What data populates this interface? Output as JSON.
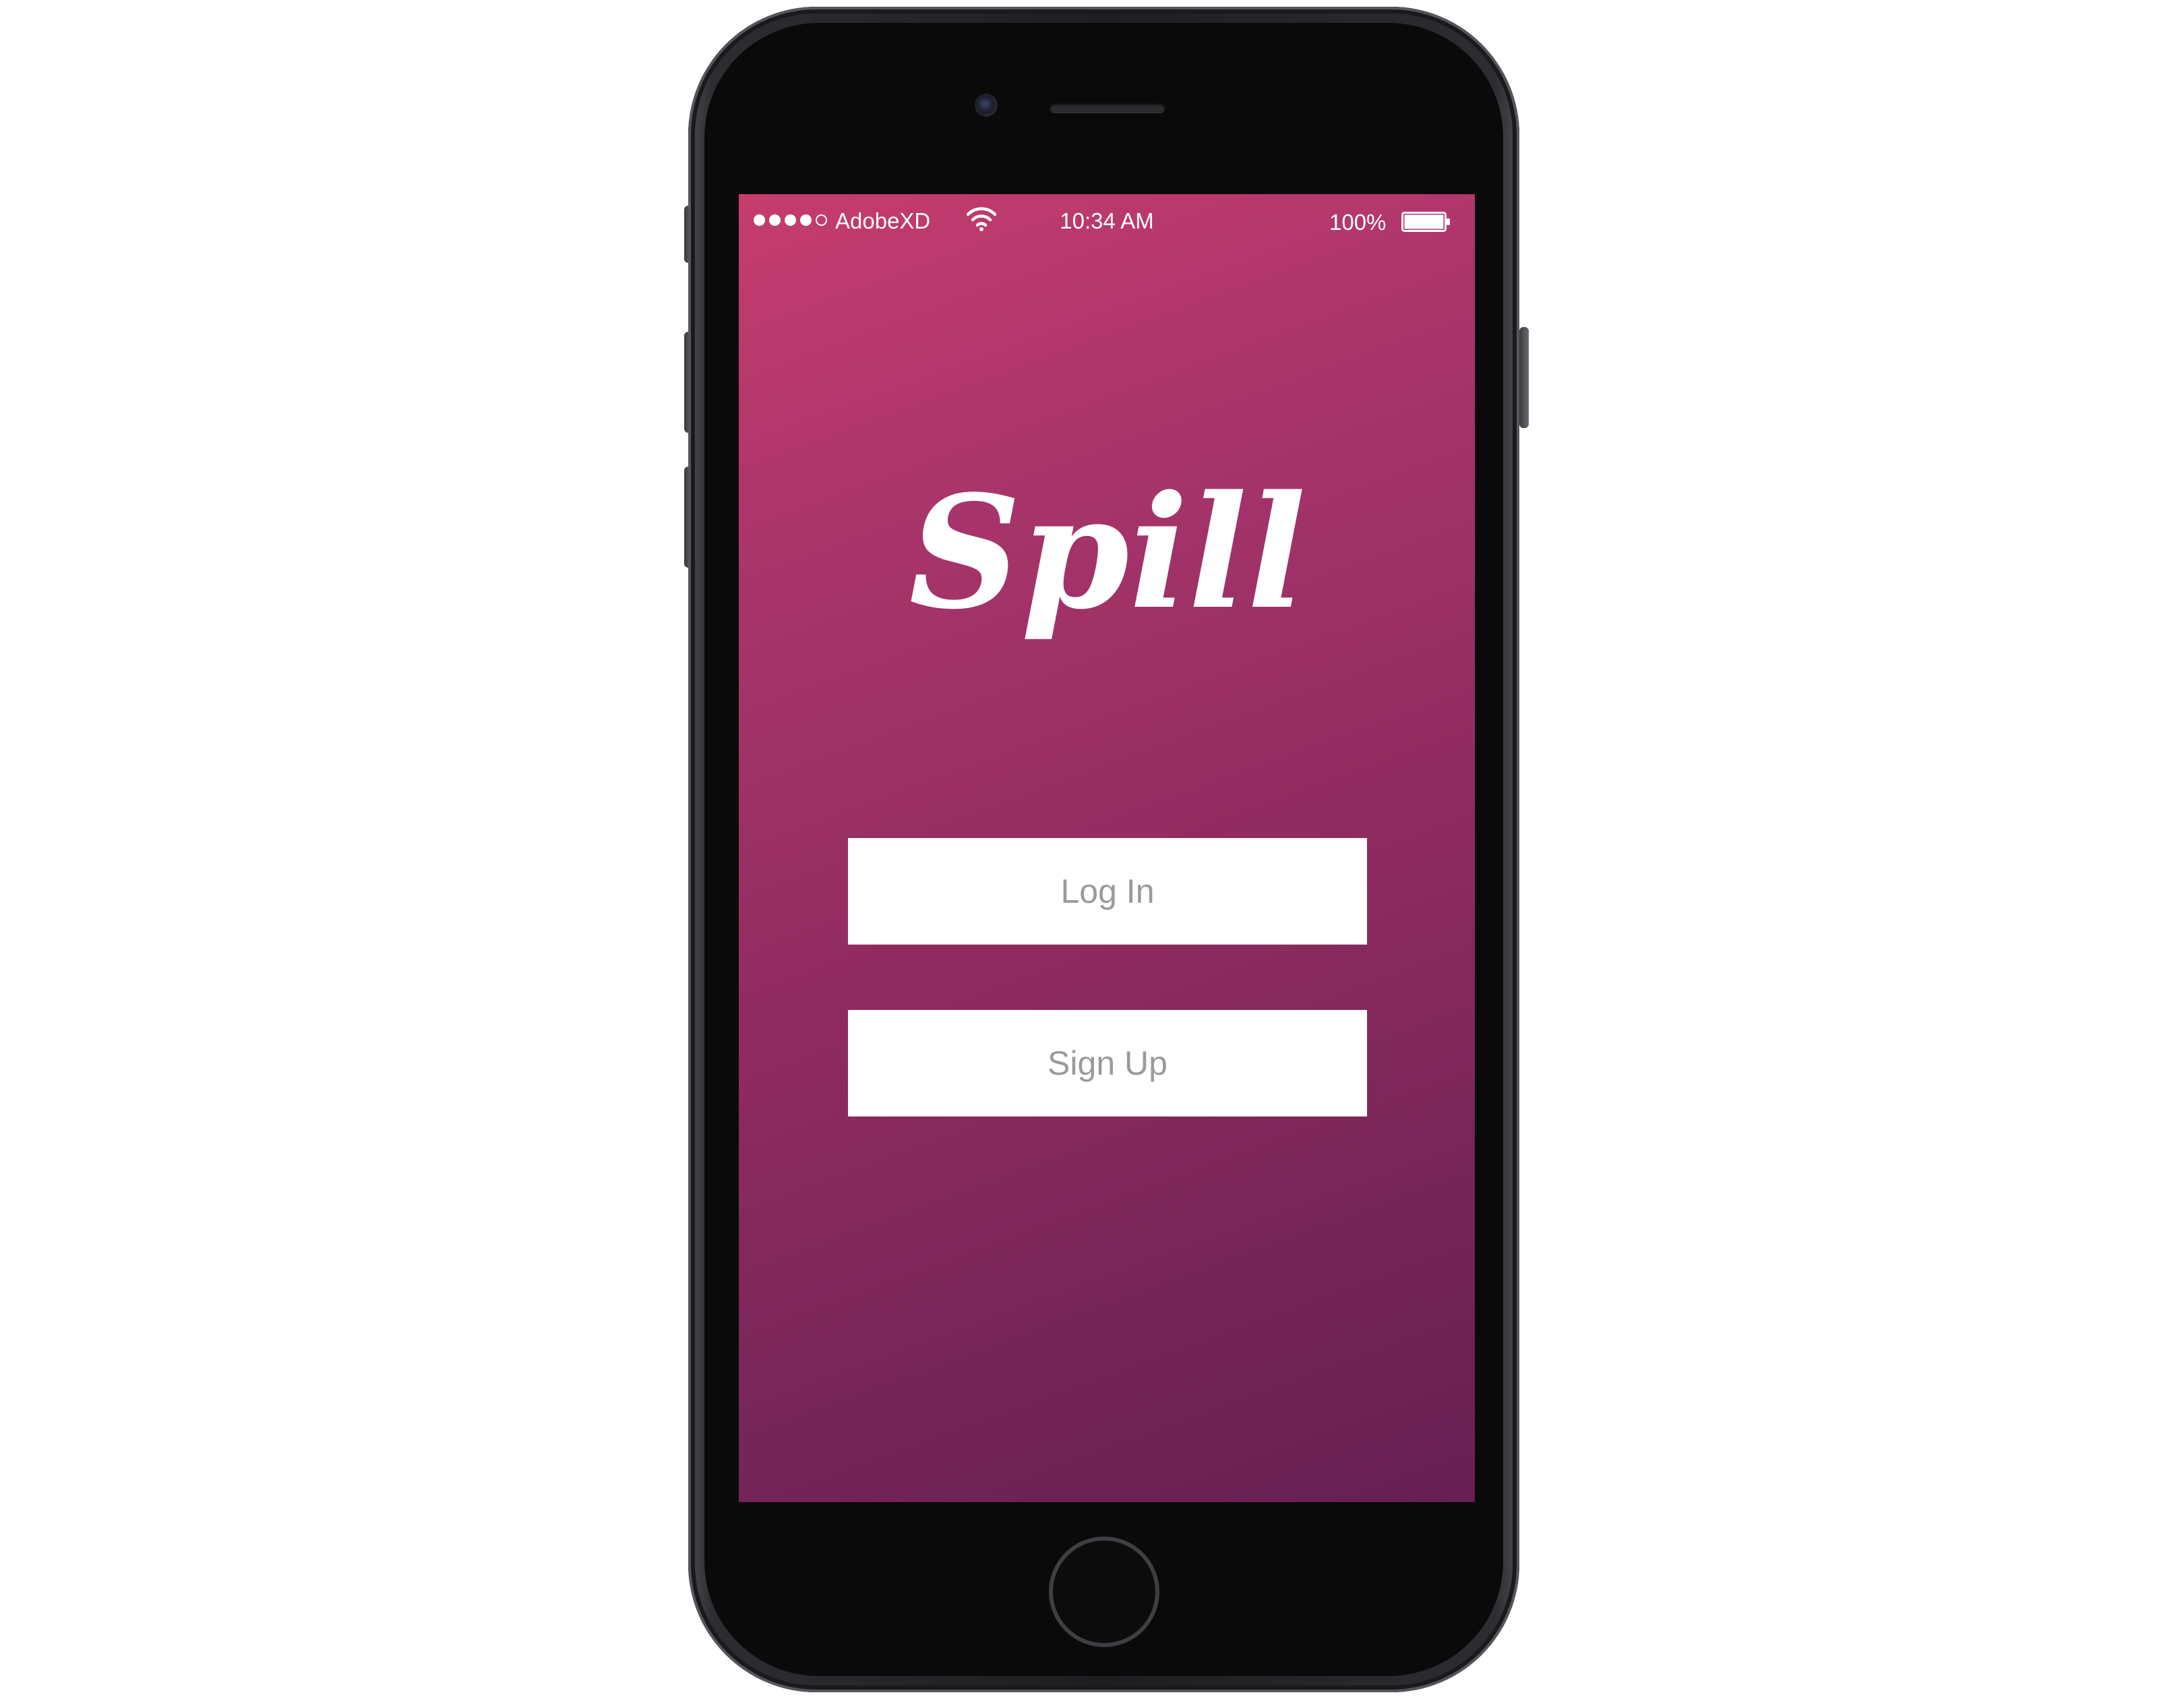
{
  "status_bar": {
    "carrier": "AdobeXD",
    "time": "10:34 AM",
    "battery_percent": "100%",
    "signal_bars_filled": 4,
    "signal_bars_total": 5,
    "battery_level": 1.0
  },
  "app": {
    "logo_text": "Spill",
    "background_gradient": [
      "#c63c6d",
      "#661f51"
    ]
  },
  "buttons": {
    "login_label": "Log In",
    "signup_label": "Sign Up"
  },
  "icons": {
    "wifi": "wifi-icon",
    "battery": "battery-icon",
    "home": "home-button"
  }
}
